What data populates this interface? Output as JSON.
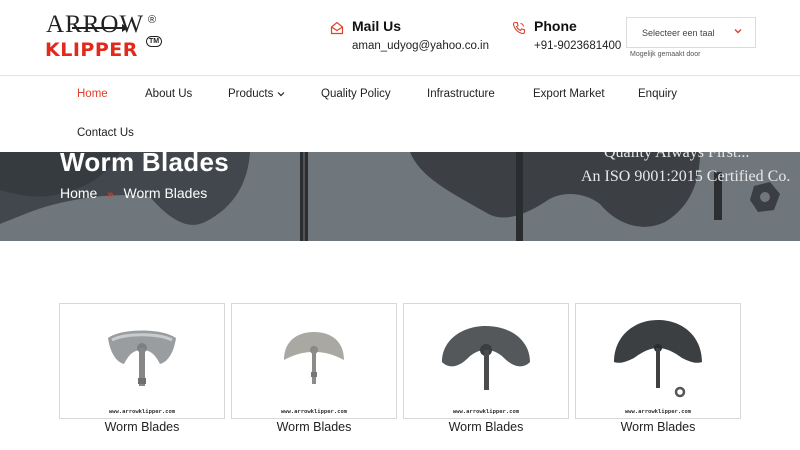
{
  "brand": {
    "line1": "ARROW",
    "line2": "KLIPPER",
    "reg": "®",
    "tm": "TM"
  },
  "contact": {
    "mail": {
      "title": "Mail Us",
      "value": "aman_udyog@yahoo.co.in",
      "icon": "mail-icon"
    },
    "phone": {
      "title": "Phone",
      "value": "+91-9023681400",
      "icon": "phone-icon"
    }
  },
  "language": {
    "selected": "Selecteer een taal",
    "powered_by": "Mogelijk gemaakt door"
  },
  "nav": {
    "items": [
      {
        "label": "Home",
        "active": true
      },
      {
        "label": "About Us"
      },
      {
        "label": "Products"
      },
      {
        "label": "Quality Policy"
      },
      {
        "label": "Infrastructure"
      },
      {
        "label": "Export Market"
      },
      {
        "label": "Enquiry"
      },
      {
        "label": "Contact Us"
      }
    ]
  },
  "banner": {
    "title": "Worm Blades",
    "breadcrumb": {
      "home": "Home",
      "separator": "»",
      "current": "Worm Blades"
    },
    "quote1": "Quality Always First...",
    "quote2": "An ISO 9001:2015 Certified Co."
  },
  "products": [
    {
      "caption": "Worm Blades",
      "url": "www.arrowklipper.com"
    },
    {
      "caption": "Worm Blades",
      "url": "www.arrowklipper.com"
    },
    {
      "caption": "Worm Blades",
      "url": "www.arrowklipper.com"
    },
    {
      "caption": "Worm Blades",
      "url": "www.arrowklipper.com"
    }
  ],
  "colors": {
    "accent": "#e0402c",
    "brand_red": "#e02a1c",
    "banner_overlay": "#727980"
  }
}
